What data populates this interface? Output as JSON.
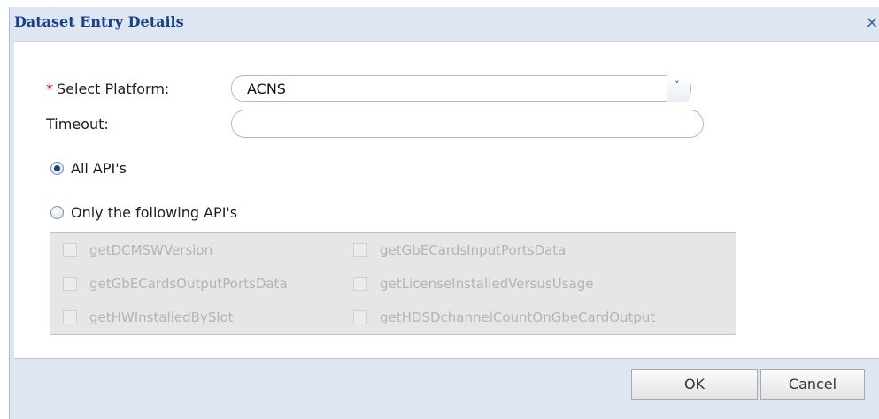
{
  "dialog": {
    "title": "Dataset Entry Details",
    "close_glyph": "✕",
    "close_icon": "close-icon"
  },
  "form": {
    "platform_required_mark": "*",
    "platform_label": "Select Platform:",
    "platform_value": "ACNS",
    "platform_arrow_icon": "chevron-down-icon",
    "timeout_label": "Timeout:",
    "timeout_value": "",
    "radio_all_label": "All API's",
    "radio_all_checked": true,
    "radio_only_label": "Only the following API's",
    "radio_only_checked": false
  },
  "api_list": [
    "getDCMSWVersion",
    "getGbECardsInputPortsData",
    "getGbECardsOutputPortsData",
    "getLicenseInstalledVersusUsage",
    "getHWInstalledBySlot",
    "getHDSDchannelCountOnGbeCardOutput"
  ],
  "footer": {
    "ok_label": "OK",
    "cancel_label": "Cancel"
  },
  "colors": {
    "title_text": "#15428b",
    "panel_bg": "#dde6f1",
    "required_star": "#d00000",
    "disabled_text": "#b4b4b4"
  }
}
